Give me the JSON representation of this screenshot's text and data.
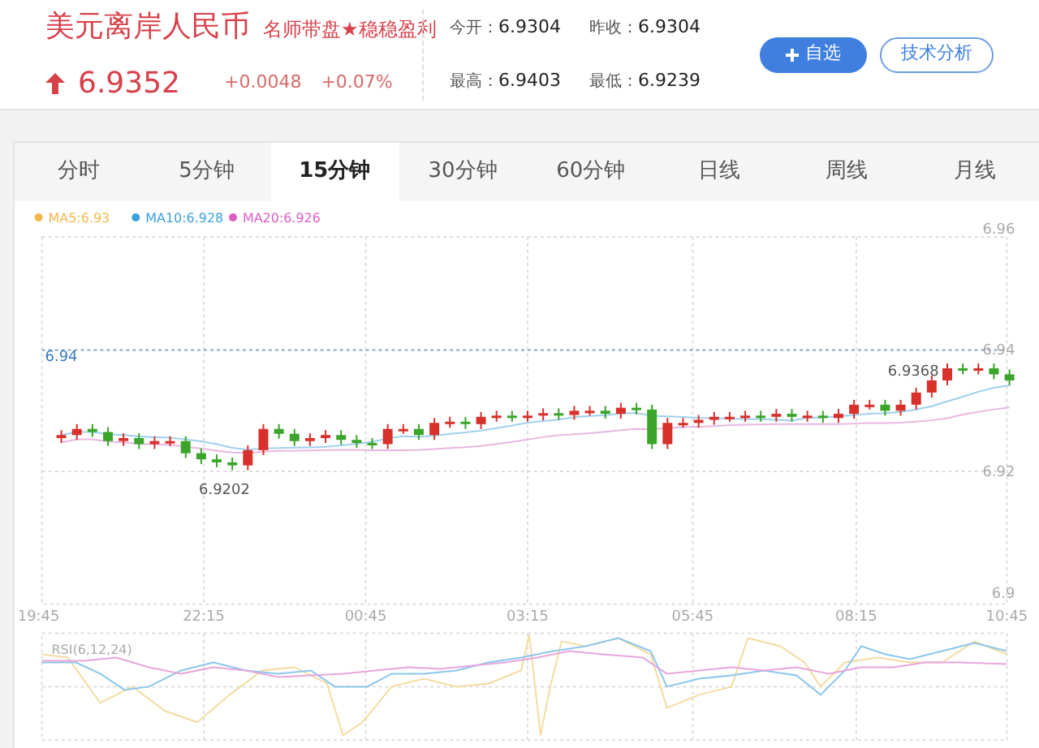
{
  "quote": {
    "name": "美元离岸人民币",
    "promo": "名师带盘★稳稳盈利",
    "price_up": true,
    "price": "6.9352",
    "change": "+0.0048",
    "change_pct": "+0.07%"
  },
  "stats": [
    {
      "label": "今开：",
      "value": "6.9304"
    },
    {
      "label": "昨收：",
      "value": "6.9304"
    },
    {
      "label": "最高：",
      "value": "6.9403"
    },
    {
      "label": "最低：",
      "value": "6.9239"
    }
  ],
  "buttons": [
    {
      "label": "自选",
      "kind": "primary"
    },
    {
      "label": "技术分析",
      "kind": "outline"
    }
  ],
  "tabs": [
    {
      "label": "分时",
      "selected": false
    },
    {
      "label": "5分钟",
      "selected": false
    },
    {
      "label": "15分钟",
      "selected": true
    },
    {
      "label": "30分钟",
      "selected": false
    },
    {
      "label": "60分钟",
      "selected": false
    },
    {
      "label": "日线",
      "selected": false
    },
    {
      "label": "周线",
      "selected": false
    },
    {
      "label": "月线",
      "selected": false
    }
  ],
  "chart": {
    "legend": [
      {
        "label": "MA5:6.93",
        "color": "#f2b84b"
      },
      {
        "label": "MA10:6.928",
        "color": "#3b9fdc"
      },
      {
        "label": "MA20:6.926",
        "color": "#de5cc4"
      }
    ],
    "price_ticks": [
      "6.96",
      "6.94",
      "6.92",
      "6.9"
    ],
    "current_line_label": "6.94",
    "low_label": "6.9202",
    "high_label": "6.9368",
    "time_ticks": [
      "19:45",
      "22:15",
      "00:45",
      "03:15",
      "05:45",
      "08:15",
      "10:45"
    ],
    "rsi_label": "RSI(6,12,24)"
  }
}
